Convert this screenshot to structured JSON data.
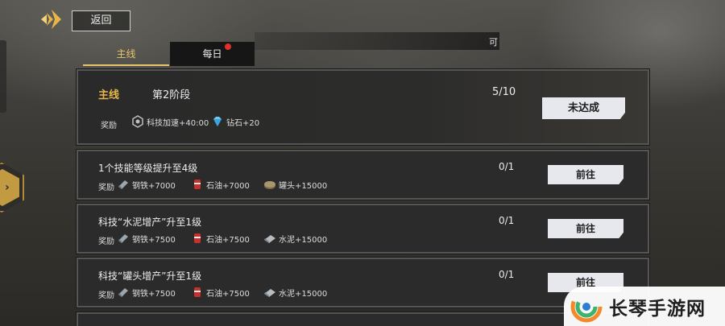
{
  "header": {
    "back_label": "返回",
    "top_bar_label": "可"
  },
  "tabs": [
    {
      "label": "主线",
      "active": true
    },
    {
      "label": "每日",
      "active": false,
      "has_notification": true
    }
  ],
  "main_quest": {
    "category_label": "主线",
    "stage": "第2阶段",
    "progress": "5/10",
    "reward_label": "奖励",
    "rewards": [
      {
        "icon": "tech-speedup-icon",
        "text": "科技加速+40:00"
      },
      {
        "icon": "diamond-icon",
        "text": "钻石+20"
      }
    ],
    "status_label": "未达成"
  },
  "tasks": [
    {
      "title": "1个技能等级提升至4级",
      "progress": "0/1",
      "reward_label": "奖励",
      "rewards": [
        {
          "icon": "steel-icon",
          "text": "钢铁+7000"
        },
        {
          "icon": "oil-icon",
          "text": "石油+7000"
        },
        {
          "icon": "canned-food-icon",
          "text": "罐头+15000"
        }
      ],
      "button_label": "前往"
    },
    {
      "title": "科技“水泥增产”升至1级",
      "progress": "0/1",
      "reward_label": "奖励",
      "rewards": [
        {
          "icon": "steel-icon",
          "text": "钢铁+7500"
        },
        {
          "icon": "oil-icon",
          "text": "石油+7500"
        },
        {
          "icon": "cement-icon",
          "text": "水泥+15000"
        }
      ],
      "button_label": "前往"
    },
    {
      "title": "科技“罐头增产”升至1级",
      "progress": "0/1",
      "reward_label": "奖励",
      "rewards": [
        {
          "icon": "steel-icon",
          "text": "钢铁+7500"
        },
        {
          "icon": "oil-icon",
          "text": "石油+7500"
        },
        {
          "icon": "cement-icon",
          "text": "水泥+15000"
        }
      ],
      "button_label": "前往"
    }
  ],
  "watermark": {
    "text": "长琴手游网"
  },
  "colors": {
    "accent_gold": "#e6b64a",
    "button_bg": "#e6e8ee",
    "notification_red": "#e0302a"
  }
}
